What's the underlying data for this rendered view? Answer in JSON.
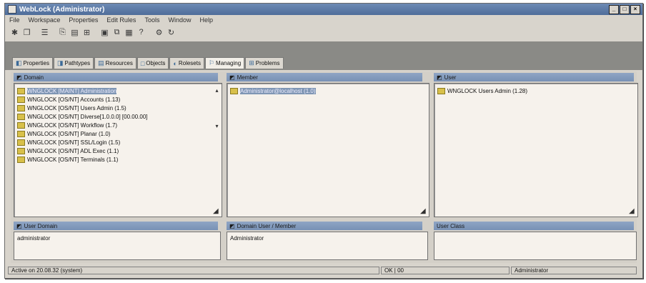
{
  "window": {
    "title": "WebLock (Administrator)",
    "controls": [
      "_",
      "□",
      "×"
    ]
  },
  "menu": [
    "File",
    "Workspace",
    "Properties",
    "Edit Rules",
    "Tools",
    "Window",
    "Help"
  ],
  "toolbar": [
    {
      "name": "new-icon",
      "glyph": "✱"
    },
    {
      "name": "open-icon",
      "glyph": "❐"
    },
    {
      "name": "sep"
    },
    {
      "name": "properties-icon",
      "glyph": "☰"
    },
    {
      "name": "sep"
    },
    {
      "name": "copy-icon",
      "glyph": "⎘"
    },
    {
      "name": "paste-icon",
      "glyph": "▤"
    },
    {
      "name": "filter-icon",
      "glyph": "⊞"
    },
    {
      "name": "sep"
    },
    {
      "name": "view-icon",
      "glyph": "▣"
    },
    {
      "name": "link-icon",
      "glyph": "⧉"
    },
    {
      "name": "grid-icon",
      "glyph": "▦"
    },
    {
      "name": "help-icon",
      "glyph": "?"
    },
    {
      "name": "sep"
    },
    {
      "name": "gear-icon",
      "glyph": "⚙"
    },
    {
      "name": "refresh-icon",
      "glyph": "↻"
    }
  ],
  "tabs": [
    {
      "label": "Properties",
      "icon": "◧",
      "active": false
    },
    {
      "label": "Pathtypes",
      "icon": "◨",
      "active": false
    },
    {
      "label": "Resources",
      "icon": "▤",
      "active": false
    },
    {
      "label": "Objects",
      "icon": "□",
      "active": false
    },
    {
      "label": "Rolesets",
      "icon": "◐",
      "active": false
    },
    {
      "label": "Managing",
      "icon": "⚐",
      "active": true
    },
    {
      "label": "Problems",
      "icon": "⊞",
      "active": false
    }
  ],
  "panels": {
    "domain": {
      "title": "Domain",
      "items": [
        {
          "label": "WNGLOCK [MAINT] Administration",
          "selected": true
        },
        {
          "label": "WNGLOCK [OS/NT] Accounts (1.13)",
          "selected": false
        },
        {
          "label": "WNGLOCK [OS/NT] Users Admin (1.5)",
          "selected": false
        },
        {
          "label": "WNGLOCK [OS/NT] Diverse[1.0.0.0] [00.00.00]",
          "selected": false
        },
        {
          "label": "WNGLOCK [OS/NT] Workflow (1.7)",
          "selected": false
        },
        {
          "label": "WNGLOCK [OS/NT] Planar (1.0)",
          "selected": false
        },
        {
          "label": "WNGLOCK [OS/NT] SSL/Login (1.5)",
          "selected": false
        },
        {
          "label": "WNGLOCK [OS/NT] ADL Exec (1.1)",
          "selected": false
        },
        {
          "label": "WNGLOCK [OS/NT] Terminals (1.1)",
          "selected": false
        }
      ]
    },
    "member": {
      "title": "Member",
      "items": [
        {
          "label": "Administrator@localhost (1.0)",
          "selected": true
        }
      ]
    },
    "user": {
      "title": "User",
      "items": [
        {
          "label": "WNGLOCK Users Admin (1.28)",
          "selected": false
        }
      ]
    }
  },
  "fields": {
    "user_domain": {
      "label": "User Domain",
      "value": "administrator"
    },
    "domain_user": {
      "label": "Domain User / Member",
      "value": "Administrator"
    },
    "user_class": {
      "label": "User Class",
      "value": ""
    }
  },
  "status": {
    "left": "Active on 20.08.32 (system)",
    "middle": "OK | 00",
    "right": "Administrator"
  },
  "colors": {
    "titlebar": "#5a78a6",
    "panel_header": "#8199bb",
    "selection": "#7f96b4",
    "window_bg": "#d8d4cc"
  }
}
